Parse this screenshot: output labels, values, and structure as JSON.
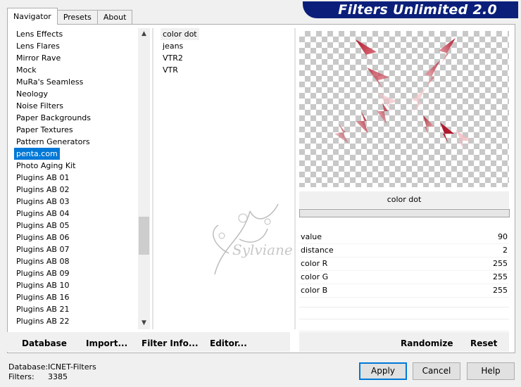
{
  "app": {
    "title": "Filters Unlimited 2.0"
  },
  "tabs": [
    {
      "label": "Navigator"
    },
    {
      "label": "Presets"
    },
    {
      "label": "About"
    }
  ],
  "categories": [
    "Lens Effects",
    "Lens Flares",
    "Mirror Rave",
    "Mock",
    "MuRa's Seamless",
    "Neology",
    "Noise Filters",
    "Paper Backgrounds",
    "Paper Textures",
    "Pattern Generators",
    "penta.com",
    "Photo Aging Kit",
    "Plugins AB 01",
    "Plugins AB 02",
    "Plugins AB 03",
    "Plugins AB 04",
    "Plugins AB 05",
    "Plugins AB 06",
    "Plugins AB 07",
    "Plugins AB 08",
    "Plugins AB 09",
    "Plugins AB 10",
    "Plugins AB 16",
    "Plugins AB 21",
    "Plugins AB 22"
  ],
  "selected_category": "penta.com",
  "filters": [
    "color dot",
    "jeans",
    "VTR2",
    "VTR"
  ],
  "selected_filter": "color dot",
  "filter_name": "color dot",
  "params": [
    {
      "label": "value",
      "value": "90"
    },
    {
      "label": "distance",
      "value": "2"
    },
    {
      "label": "color R",
      "value": "255"
    },
    {
      "label": "color G",
      "value": "255"
    },
    {
      "label": "color B",
      "value": "255"
    }
  ],
  "bottom_left_buttons": {
    "database": "Database",
    "import": "Import...",
    "filter_info": "Filter Info...",
    "editor": "Editor..."
  },
  "bottom_right_buttons": {
    "randomize": "Randomize",
    "reset": "Reset"
  },
  "status": {
    "database_label": "Database:",
    "database_value": "ICNET-Filters",
    "filters_label": "Filters:",
    "filters_value": "3385"
  },
  "dialog_buttons": {
    "apply": "Apply",
    "cancel": "Cancel",
    "help": "Help"
  },
  "watermark_text": "Sylviane",
  "colors": {
    "accent": "#0078d7",
    "title_bg": "#0b1f7a",
    "arrow_red": "#b0182c"
  }
}
